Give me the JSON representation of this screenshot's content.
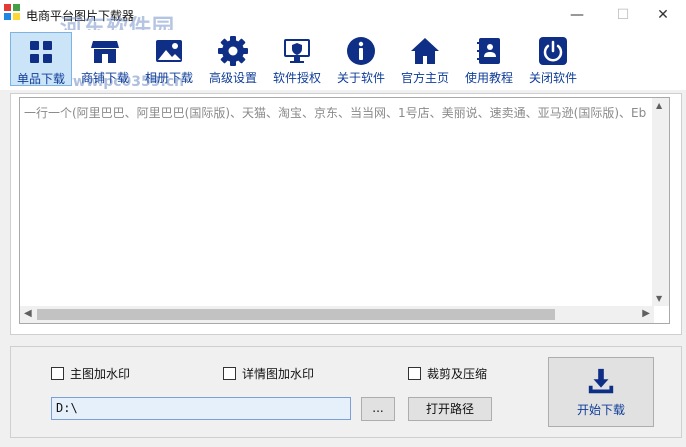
{
  "window": {
    "title": "电商平台图片下载器",
    "watermark": "河东软件园",
    "watermark_url": "www.pc0359.cn",
    "minimize": "—",
    "maximize": "☐",
    "close": "✕"
  },
  "toolbar": {
    "items": [
      {
        "label": "单品下载",
        "icon": "grid-icon",
        "active": true
      },
      {
        "label": "商铺下载",
        "icon": "store-icon"
      },
      {
        "label": "相册下载",
        "icon": "photo-icon"
      },
      {
        "label": "高级设置",
        "icon": "gear-icon"
      },
      {
        "label": "软件授权",
        "icon": "monitor-shield-icon"
      },
      {
        "label": "关于软件",
        "icon": "info-icon"
      },
      {
        "label": "官方主页",
        "icon": "home-icon"
      },
      {
        "label": "使用教程",
        "icon": "contact-book-icon"
      },
      {
        "label": "关闭软件",
        "icon": "power-icon"
      }
    ],
    "icon_color": "#0f2e86"
  },
  "input": {
    "placeholder": "一行一个(阿里巴巴、阿里巴巴(国际版)、天猫、淘宝、京东、当当网、1号店、美丽说、速卖通、亚马逊(国际版)、Eb"
  },
  "options": {
    "main_watermark": "主图加水印",
    "detail_watermark": "详情图加水印",
    "crop_compress": "裁剪及压缩"
  },
  "path": {
    "value": "D:\\",
    "browse_label": "...",
    "open_label": "打开路径"
  },
  "start": {
    "label": "开始下载"
  }
}
